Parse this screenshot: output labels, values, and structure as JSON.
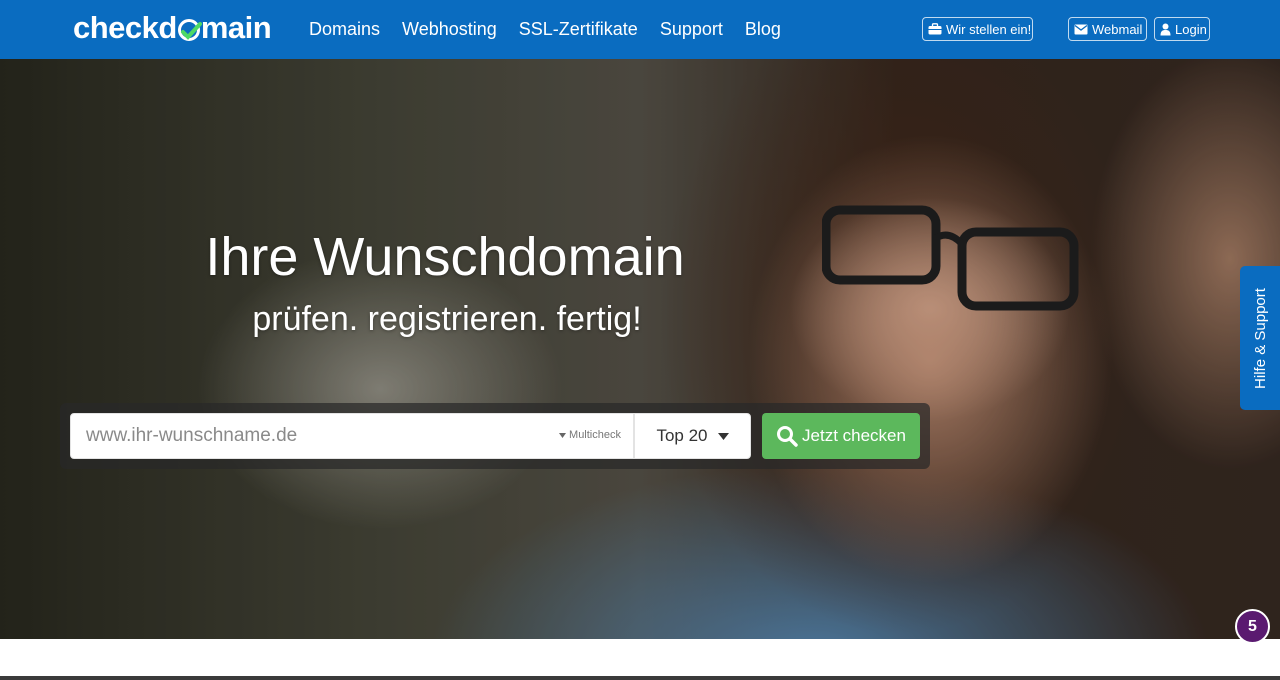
{
  "header": {
    "logo_text_before": "checkd",
    "logo_text_after": "main",
    "nav": [
      {
        "label": "Domains"
      },
      {
        "label": "Webhosting"
      },
      {
        "label": "SSL-Zertifikate"
      },
      {
        "label": "Support"
      },
      {
        "label": "Blog"
      }
    ],
    "jobs_label": "Wir stellen ein!",
    "webmail_label": "Webmail",
    "login_label": "Login"
  },
  "hero": {
    "title": "Ihre Wunschdomain",
    "subtitle": "prüfen. registrieren. fertig!"
  },
  "search": {
    "placeholder": "www.ihr-wunschname.de",
    "value": "",
    "multicheck_label": "Multicheck",
    "tld_selected": "Top 20",
    "button_label": "Jetzt checken"
  },
  "side_tab": {
    "label": "Hilfe & Support"
  },
  "notification": {
    "count": "5"
  },
  "colors": {
    "brand_blue": "#0a6cc0",
    "button_green": "#5cb85c",
    "badge_purple": "#5a1a70"
  },
  "icons": {
    "jobs": "briefcase-icon",
    "webmail": "envelope-icon",
    "login": "user-icon",
    "search_button": "search-icon",
    "select": "caret-down-icon"
  }
}
